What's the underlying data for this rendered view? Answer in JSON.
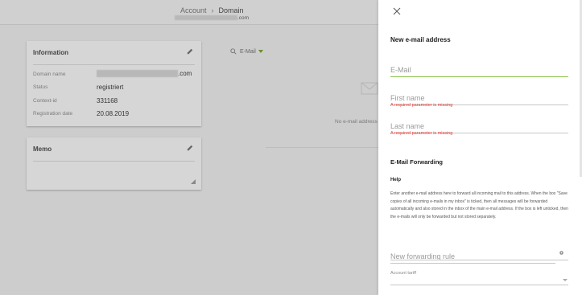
{
  "header": {
    "breadcrumb": [
      "Account",
      "Domain"
    ],
    "breadcrumb_separator": "›",
    "domain_suffix": ".com"
  },
  "info_card": {
    "title": "Information",
    "rows": [
      {
        "label": "Domain name",
        "value": ".com"
      },
      {
        "label": "Status",
        "value": "registriert"
      },
      {
        "label": "Context-id",
        "value": "331168"
      },
      {
        "label": "Registration date",
        "value": "20.08.2019"
      }
    ]
  },
  "memo_card": {
    "title": "Memo"
  },
  "email_list": {
    "filter_label": "E-Mail",
    "empty_text": "No e-mail address"
  },
  "panel": {
    "title": "New e-mail address",
    "email_placeholder": "E-Mail",
    "first_name_placeholder": "First name",
    "first_name_error": "A required parameter is missing",
    "last_name_placeholder": "Last name",
    "last_name_error": "A required parameter is missing",
    "forwarding_title": "E-Mail Forwarding",
    "help_title": "Help",
    "help_text": "Enter another e-mail address here to forward all incoming mail to this address. When the box \"Save copies of all incoming e-mails in my inbox\" is ticked, then all messages will be forwarded automatically and also stored in the inbox of the main e-mail address. If the box is left unticked, then the e-mails will only be forwarded but not stored separately.",
    "forwarding_placeholder": "New forwarding rule",
    "tariff_label": "Account tariff"
  },
  "colors": {
    "accent_green": "#8bc34a",
    "error_red": "#e53935"
  }
}
